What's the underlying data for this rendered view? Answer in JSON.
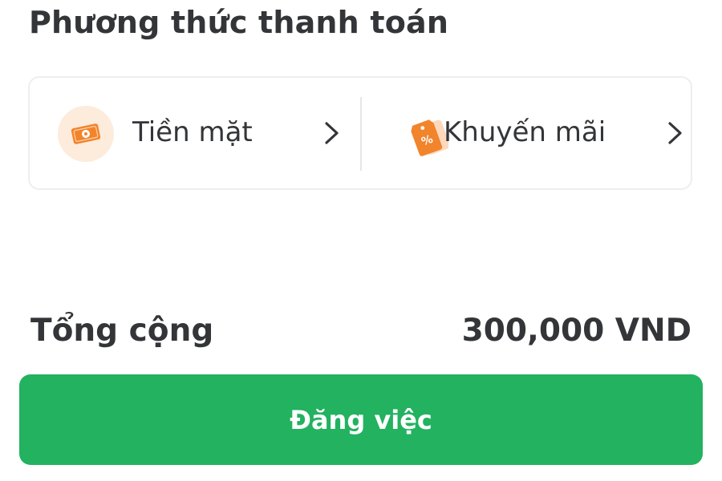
{
  "payment_section": {
    "title": "Phương thức thanh toán",
    "options": [
      {
        "label": "Tiền mặt",
        "icon": "cash-icon"
      },
      {
        "label": "Khuyến mãi",
        "icon": "discount-tag-icon"
      }
    ]
  },
  "summary": {
    "total_label": "Tổng cộng",
    "total_value": "300,000 VND"
  },
  "actions": {
    "submit_label": "Đăng việc"
  },
  "colors": {
    "primary_green": "#22b260",
    "accent_orange": "#f2842c",
    "icon_bg": "#fdebdc",
    "text": "#333538"
  }
}
